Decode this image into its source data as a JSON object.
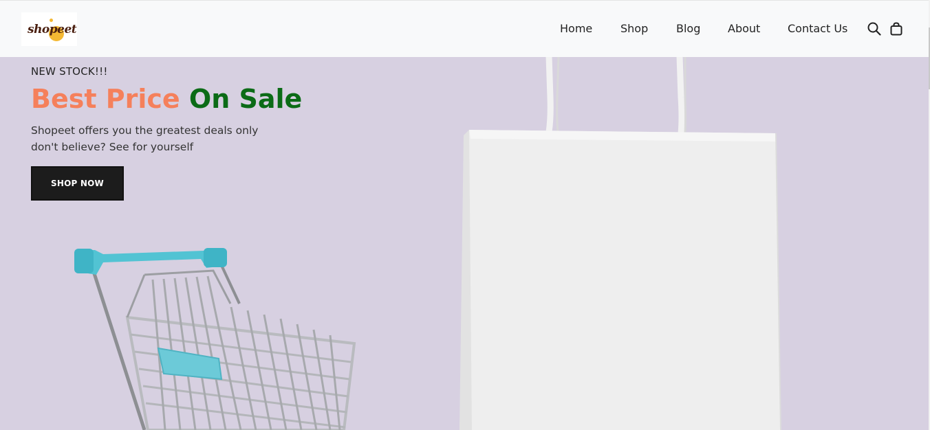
{
  "header": {
    "logo_text": "shopeet",
    "nav": [
      {
        "label": "Home"
      },
      {
        "label": "Shop"
      },
      {
        "label": "Blog"
      },
      {
        "label": "About"
      },
      {
        "label": "Contact Us"
      }
    ],
    "icons": {
      "search": "search-icon",
      "cart": "shopping-bag-icon"
    }
  },
  "hero": {
    "eyebrow": "NEW STOCK!!!",
    "headline_part1": "Best Price",
    "headline_part2": "On Sale",
    "subtext_line1": "Shopeet offers you the greatest deals only",
    "subtext_line2": "don't believe? See for yourself",
    "cta_label": "SHOP NOW"
  },
  "colors": {
    "hero_background": "#d7d0e1",
    "headline_orange": "#f5805b",
    "headline_green": "#0b6b16",
    "cta_background": "#1c1c1c",
    "cart_handle": "#4fc3d4",
    "logo_accent": "#f4b833"
  }
}
